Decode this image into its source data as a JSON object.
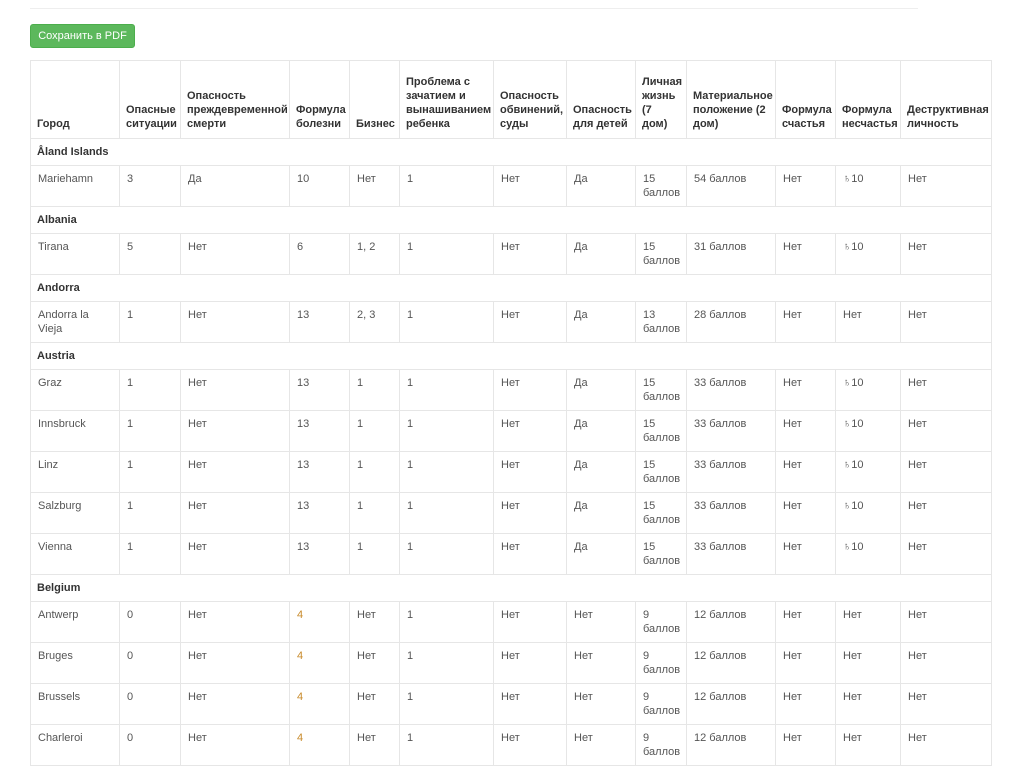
{
  "toolbar": {
    "save_pdf_label": "Сохранить в PDF"
  },
  "table": {
    "headers": [
      "Город",
      "Опасные ситуации",
      "Опасность преждевременной смерти",
      "Формула болезни",
      "Бизнес",
      "Проблема с зачатием и вынашиванием ребенка",
      "Опасность обвинений, суды",
      "Опасность для детей",
      "Личная жизнь (7 дом)",
      "Материальное положение (2 дом)",
      "Формула счастья",
      "Формула несчастья",
      "Деструктивная личность"
    ],
    "groups": [
      {
        "country": "Åland Islands",
        "rows": [
          [
            "Mariehamn",
            "3",
            "Да",
            "10",
            "Нет",
            "1",
            "Нет",
            "Да",
            "15 баллов",
            "54 баллов",
            "Нет",
            "♄10",
            "Нет"
          ]
        ]
      },
      {
        "country": "Albania",
        "rows": [
          [
            "Tirana",
            "5",
            "Нет",
            "6",
            "1, 2",
            "1",
            "Нет",
            "Да",
            "15 баллов",
            "31 баллов",
            "Нет",
            "♄10",
            "Нет"
          ]
        ]
      },
      {
        "country": "Andorra",
        "rows": [
          [
            "Andorra la Vieja",
            "1",
            "Нет",
            "13",
            "2, 3",
            "1",
            "Нет",
            "Да",
            "13 баллов",
            "28 баллов",
            "Нет",
            "Нет",
            "Нет"
          ]
        ]
      },
      {
        "country": "Austria",
        "rows": [
          [
            "Graz",
            "1",
            "Нет",
            "13",
            "1",
            "1",
            "Нет",
            "Да",
            "15 баллов",
            "33 баллов",
            "Нет",
            "♄10",
            "Нет"
          ],
          [
            "Innsbruck",
            "1",
            "Нет",
            "13",
            "1",
            "1",
            "Нет",
            "Да",
            "15 баллов",
            "33 баллов",
            "Нет",
            "♄10",
            "Нет"
          ],
          [
            "Linz",
            "1",
            "Нет",
            "13",
            "1",
            "1",
            "Нет",
            "Да",
            "15 баллов",
            "33 баллов",
            "Нет",
            "♄10",
            "Нет"
          ],
          [
            "Salzburg",
            "1",
            "Нет",
            "13",
            "1",
            "1",
            "Нет",
            "Да",
            "15 баллов",
            "33 баллов",
            "Нет",
            "♄10",
            "Нет"
          ],
          [
            "Vienna",
            "1",
            "Нет",
            "13",
            "1",
            "1",
            "Нет",
            "Да",
            "15 баллов",
            "33 баллов",
            "Нет",
            "♄10",
            "Нет"
          ]
        ]
      },
      {
        "country": "Belgium",
        "rows": [
          [
            "Antwerp",
            "0",
            "Нет",
            "4",
            "Нет",
            "1",
            "Нет",
            "Нет",
            "9 баллов",
            "12 баллов",
            "Нет",
            "Нет",
            "Нет"
          ],
          [
            "Bruges",
            "0",
            "Нет",
            "4",
            "Нет",
            "1",
            "Нет",
            "Нет",
            "9 баллов",
            "12 баллов",
            "Нет",
            "Нет",
            "Нет"
          ],
          [
            "Brussels",
            "0",
            "Нет",
            "4",
            "Нет",
            "1",
            "Нет",
            "Нет",
            "9 баллов",
            "12 баллов",
            "Нет",
            "Нет",
            "Нет"
          ],
          [
            "Charleroi",
            "0",
            "Нет",
            "4",
            "Нет",
            "1",
            "Нет",
            "Нет",
            "9 баллов",
            "12 баллов",
            "Нет",
            "Нет",
            "Нет"
          ]
        ]
      }
    ]
  },
  "colors": {
    "button_bg": "#5cb85c",
    "highlight_text": "#c88a2a"
  }
}
